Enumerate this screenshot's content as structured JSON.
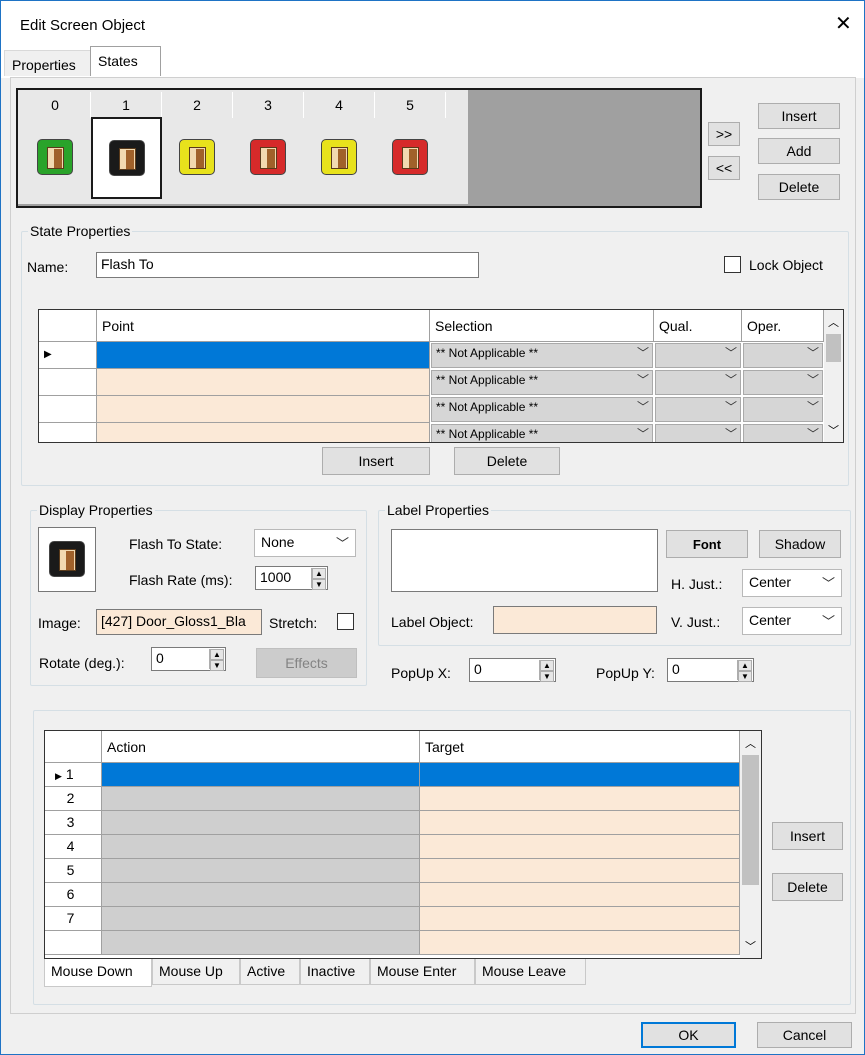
{
  "window": {
    "title": "Edit Screen Object"
  },
  "tabs": [
    "Properties",
    "States"
  ],
  "states_bar": {
    "numbers": [
      "0",
      "1",
      "2",
      "3",
      "4",
      "5"
    ],
    "icons": [
      {
        "name": "state-0-door-green-icon",
        "color": "#2aa32a"
      },
      {
        "name": "state-1-door-black-icon",
        "color": "#1a1a1a"
      },
      {
        "name": "state-2-door-yellow-icon",
        "color": "#e8e21c"
      },
      {
        "name": "state-3-door-red-icon",
        "color": "#d62a2a"
      },
      {
        "name": "state-4-door-yellow-icon",
        "color": "#e8e21c"
      },
      {
        "name": "state-5-door-red-icon",
        "color": "#d62a2a"
      }
    ],
    "next_label": ">>",
    "prev_label": "<<",
    "insert_label": "Insert",
    "add_label": "Add",
    "delete_label": "Delete"
  },
  "state_properties": {
    "group_title": "State Properties",
    "name_label": "Name:",
    "name_value": "Flash To",
    "lock_label": "Lock Object",
    "grid": {
      "headers": [
        "Point",
        "Selection",
        "Qual.",
        "Oper."
      ],
      "rows": [
        {
          "selection": "** Not Applicable **"
        },
        {
          "selection": "** Not Applicable **"
        },
        {
          "selection": "** Not Applicable **"
        },
        {
          "selection": "** Not Applicable **"
        }
      ]
    },
    "insert_label": "Insert",
    "delete_label": "Delete"
  },
  "display_properties": {
    "group_title": "Display Properties",
    "flash_state_label": "Flash To State:",
    "flash_state_value": "None",
    "flash_rate_label": "Flash Rate (ms):",
    "flash_rate_value": "1000",
    "image_label": "Image:",
    "image_value": "[427] Door_Gloss1_Bla",
    "stretch_label": "Stretch:",
    "rotate_label": "Rotate (deg.):",
    "rotate_value": "0",
    "effects_label": "Effects"
  },
  "label_properties": {
    "group_title": "Label Properties",
    "font_label": "Font",
    "shadow_label": "Shadow",
    "hjust_label": "H. Just.:",
    "hjust_value": "Center",
    "vjust_label": "V. Just.:",
    "vjust_value": "Center",
    "label_object_label": "Label Object:",
    "popup_x_label": "PopUp X:",
    "popup_x_value": "0",
    "popup_y_label": "PopUp Y:",
    "popup_y_value": "0"
  },
  "actions": {
    "headers": [
      "Action",
      "Target"
    ],
    "row_numbers": [
      "1",
      "2",
      "3",
      "4",
      "5",
      "6",
      "7"
    ],
    "insert_label": "Insert",
    "delete_label": "Delete",
    "tabs": [
      "Mouse Down",
      "Mouse Up",
      "Active",
      "Inactive",
      "Mouse Enter",
      "Mouse Leave"
    ]
  },
  "footer": {
    "ok_label": "OK",
    "cancel_label": "Cancel"
  }
}
